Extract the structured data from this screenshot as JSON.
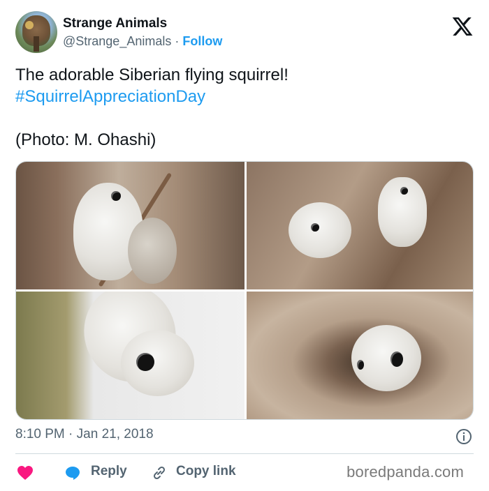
{
  "author": {
    "display_name": "Strange Animals",
    "handle": "@Strange_Animals",
    "separator": "·",
    "follow_label": "Follow"
  },
  "tweet": {
    "line1": "The adorable Siberian flying squirrel!",
    "hashtag": "#SquirrelAppreciationDay",
    "credit": "(Photo: M. Ohashi)"
  },
  "photos": [
    {
      "subject": "flying squirrel on branch"
    },
    {
      "subject": "two flying squirrels in tree bark"
    },
    {
      "subject": "flying squirrel on trunk, snowy background"
    },
    {
      "subject": "flying squirrel peeking from tree hole"
    }
  ],
  "meta": {
    "time": "8:10 PM",
    "separator": "·",
    "date": "Jan 21, 2018"
  },
  "actions": {
    "reply_label": "Reply",
    "copy_link_label": "Copy link"
  },
  "watermark": "boredpanda.com",
  "colors": {
    "accent": "#1d9bf0",
    "heart": "#f91880",
    "muted": "#536471",
    "text": "#0f1419"
  },
  "icons": [
    "x-logo-icon",
    "info-icon",
    "heart-icon",
    "reply-bubble-icon",
    "link-icon"
  ]
}
